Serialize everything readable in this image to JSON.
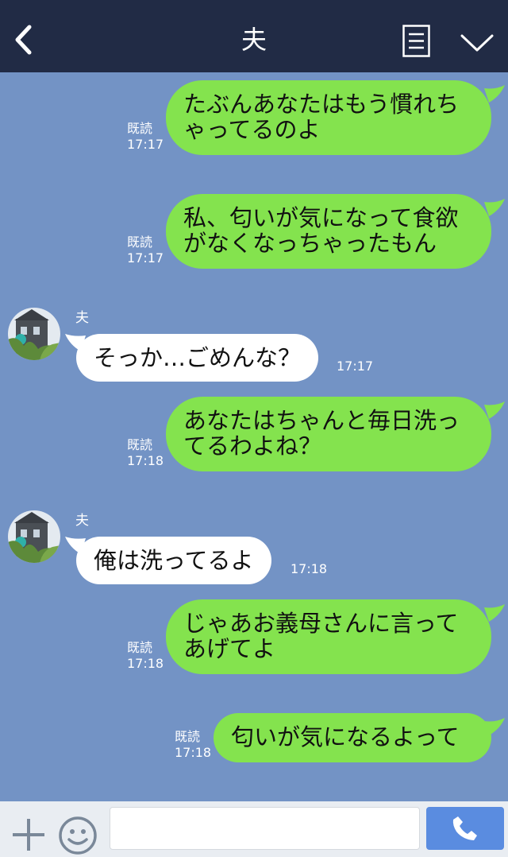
{
  "header": {
    "title": "夫",
    "icons": [
      "back-chevron-icon",
      "menu-list-icon",
      "chevron-down-icon"
    ]
  },
  "messages": [
    {
      "direction": "out",
      "lines": [
        "たぶんあなたはもう慣れち",
        "ゃってるのよ"
      ],
      "read": "既読",
      "time": "17:17"
    },
    {
      "direction": "out",
      "lines": [
        "私、匂いが気になって食欲",
        "がなくなっちゃったもん"
      ],
      "read": "既読",
      "time": "17:17"
    },
    {
      "direction": "in",
      "sender": "夫",
      "text": "そっか…ごめんな？",
      "time": "17:17"
    },
    {
      "direction": "out",
      "lines": [
        "あなたはちゃんと毎日洗っ",
        "てるわよね？"
      ],
      "read": "既読",
      "time": "17:18"
    },
    {
      "direction": "in",
      "sender": "夫",
      "text": "俺は洗ってるよ",
      "time": "17:18"
    },
    {
      "direction": "out",
      "lines": [
        "じゃあお義母さんに言って",
        "あげてよ"
      ],
      "read": "既読",
      "time": "17:18"
    },
    {
      "direction": "out",
      "lines": [
        "匂いが気になるよって"
      ],
      "read": "既読",
      "time": "17:18"
    }
  ],
  "footer": {
    "input_value": "",
    "icons": [
      "plus-icon",
      "smiley-icon",
      "phone-icon"
    ]
  },
  "colors": {
    "header_bg": "#212b45",
    "chat_bg": "#7393c5",
    "outgoing_bubble": "#84e34e",
    "incoming_bubble": "#ffffff",
    "call_button": "#5a8ce0"
  }
}
